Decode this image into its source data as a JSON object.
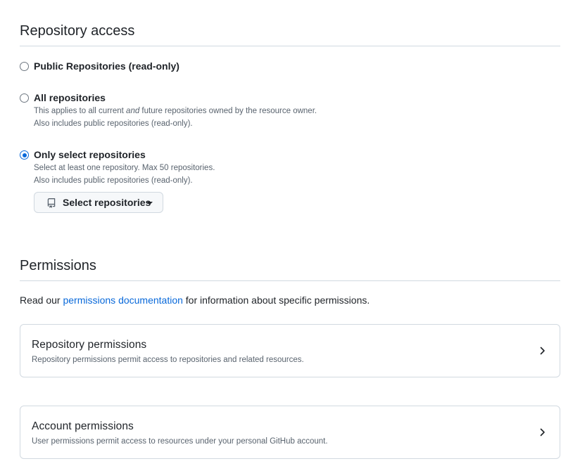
{
  "repository_access": {
    "title": "Repository access",
    "options": [
      {
        "label": "Public Repositories (read-only)",
        "checked": false
      },
      {
        "label": "All repositories",
        "checked": false,
        "note_prefix": "This applies to all current ",
        "note_em": "and",
        "note_suffix": " future repositories owned by the resource owner.",
        "note_line2": "Also includes public repositories (read-only)."
      },
      {
        "label": "Only select repositories",
        "checked": true,
        "note_line1": "Select at least one repository. Max 50 repositories.",
        "note_line2": "Also includes public repositories (read-only)."
      }
    ],
    "select_button": {
      "label": "Select repositories",
      "icon": "repo-icon"
    }
  },
  "permissions": {
    "title": "Permissions",
    "intro_prefix": "Read our ",
    "intro_link": "permissions documentation",
    "intro_suffix": " for information about specific permissions.",
    "cards": [
      {
        "title": "Repository permissions",
        "description": "Repository permissions permit access to repositories and related resources.",
        "icon": "chevron-right-icon"
      },
      {
        "title": "Account permissions",
        "description": "User permissions permit access to resources under your personal GitHub account.",
        "icon": "chevron-right-icon"
      }
    ]
  },
  "colors": {
    "accent": "#0969da",
    "border": "#d1d9e0",
    "text": "#1f2328",
    "muted": "#59636e"
  }
}
